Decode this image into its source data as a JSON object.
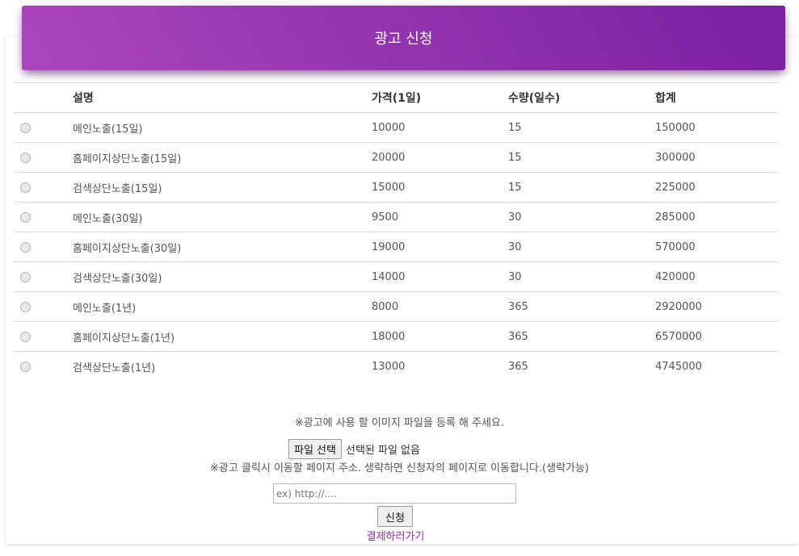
{
  "header": {
    "title": "광고 신청"
  },
  "table": {
    "columns": [
      "설명",
      "가격(1일)",
      "수량(일수)",
      "합계"
    ],
    "rows": [
      [
        "메인노출(15일)",
        "10000",
        "15",
        "150000"
      ],
      [
        "홈페이지상단노출(15일)",
        "20000",
        "15",
        "300000"
      ],
      [
        "검색상단노출(15일)",
        "15000",
        "15",
        "225000"
      ],
      [
        "메인노출(30일)",
        "9500",
        "30",
        "285000"
      ],
      [
        "홈페이지상단노출(30일)",
        "19000",
        "30",
        "570000"
      ],
      [
        "검색상단노출(30일)",
        "14000",
        "30",
        "420000"
      ],
      [
        "메인노출(1년)",
        "8000",
        "365",
        "2920000"
      ],
      [
        "홈페이지상단노출(1년)",
        "18000",
        "365",
        "6570000"
      ],
      [
        "검색상단노출(1년)",
        "13000",
        "365",
        "4745000"
      ]
    ]
  },
  "upload": {
    "notice": "※광고에 사용 할 이미지 파일을 등록 해 주세요.",
    "file_button": "파일 선택",
    "file_status": "선택된 파일 없음"
  },
  "url": {
    "notice": "※광고 클릭시 이동할 페이지 주소. 생략하면 신청자의 페이지로 이동합니다.(생략가능)",
    "placeholder": "ex) http://...."
  },
  "actions": {
    "apply_label": "신청",
    "pay_link": "결제하러가기"
  }
}
